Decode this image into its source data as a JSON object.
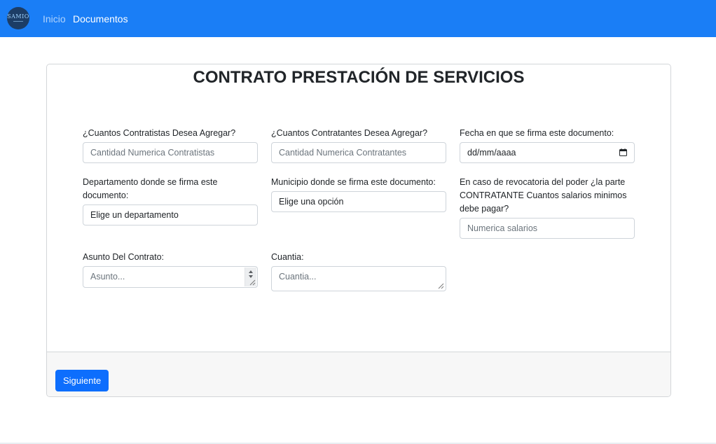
{
  "navbar": {
    "logo_text": "SAMIO",
    "links": [
      "Inicio",
      "Documentos"
    ],
    "brand_color": "#1a7ef6"
  },
  "form": {
    "title": "CONTRATO PRESTACIÓN DE SERVICIOS",
    "fields": {
      "contratistas": {
        "label": "¿Cuantos Contratistas Desea Agregar?",
        "placeholder": "Cantidad Numerica Contratistas"
      },
      "contratantes": {
        "label": "¿Cuantos Contratantes Desea Agregar?",
        "placeholder": "Cantidad Numerica Contratantes"
      },
      "fecha": {
        "label": "Fecha en que se firma este documento:",
        "value": "dd/mm/aaaa"
      },
      "departamento": {
        "label": "Departamento donde se firma este documento:",
        "value": "Elige un departamento"
      },
      "municipio": {
        "label": "Municipio donde se firma este documento:",
        "value": "Elige una opción"
      },
      "salarios": {
        "label": "En caso de revocatoria del poder ¿la parte CONTRATANTE Cuantos salarios minimos debe pagar?",
        "placeholder": "Numerica salarios"
      },
      "asunto": {
        "label": "Asunto Del Contrato:",
        "placeholder": "Asunto..."
      },
      "cuantia": {
        "label": "Cuantia:",
        "placeholder": "Cuantia..."
      }
    },
    "footer": {
      "next_label": "Siguiente"
    }
  }
}
